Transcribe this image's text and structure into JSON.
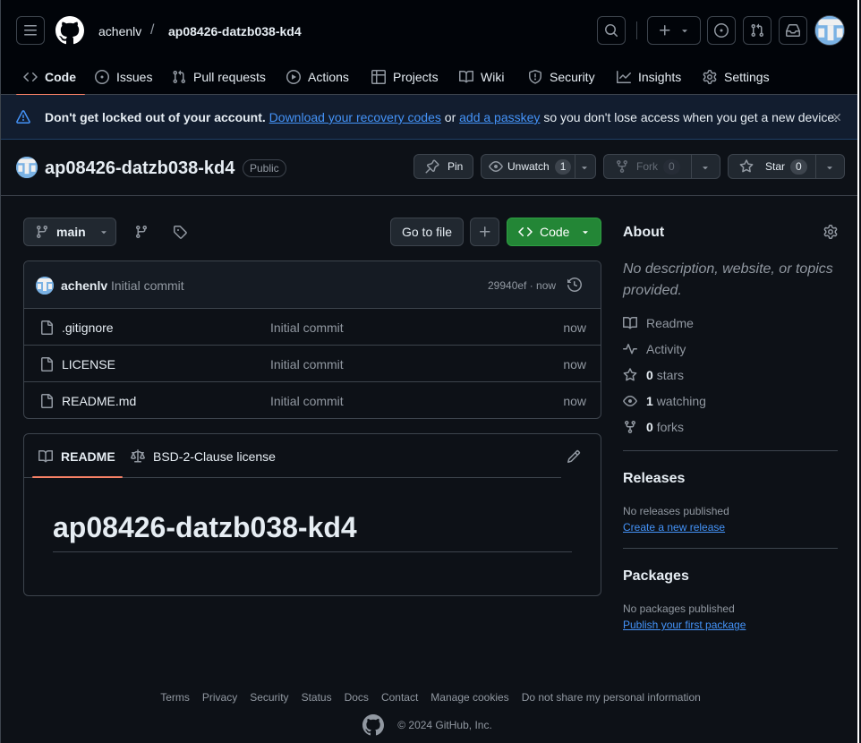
{
  "header": {
    "owner": "achenlv",
    "slash": "/",
    "repo": "ap08426-datzb038-kd4"
  },
  "tabs": [
    {
      "label": "Code"
    },
    {
      "label": "Issues"
    },
    {
      "label": "Pull requests"
    },
    {
      "label": "Actions"
    },
    {
      "label": "Projects"
    },
    {
      "label": "Wiki"
    },
    {
      "label": "Security"
    },
    {
      "label": "Insights"
    },
    {
      "label": "Settings"
    }
  ],
  "banner": {
    "lead": "Don't get locked out of your account.",
    "link1": "Download your recovery codes",
    "mid": "or",
    "link2": "add a passkey",
    "tail": "so you don't lose access when you get a new device."
  },
  "repo": {
    "name": "ap08426-datzb038-kd4",
    "visibility": "Public",
    "pin": "Pin",
    "watch": "Unwatch",
    "watch_count": "1",
    "fork": "Fork",
    "fork_count": "0",
    "star": "Star",
    "star_count": "0"
  },
  "toolbar": {
    "branch": "main",
    "go_to_file": "Go to file",
    "code": "Code"
  },
  "commit": {
    "author": "achenlv",
    "message": "Initial commit",
    "meta": "29940ef · now"
  },
  "files": [
    {
      "name": ".gitignore",
      "message": "Initial commit",
      "age": "now"
    },
    {
      "name": "LICENSE",
      "message": "Initial commit",
      "age": "now"
    },
    {
      "name": "README.md",
      "message": "Initial commit",
      "age": "now"
    }
  ],
  "readme": {
    "tab1": "README",
    "tab2": "BSD-2-Clause license",
    "heading": "ap08426-datzb038-kd4"
  },
  "about": {
    "title": "About",
    "description": "No description, website, or topics provided.",
    "readme": "Readme",
    "activity": "Activity",
    "stars_n": "0",
    "stars": "stars",
    "watching_n": "1",
    "watching": "watching",
    "forks_n": "0",
    "forks": "forks"
  },
  "releases": {
    "title": "Releases",
    "empty": "No releases published",
    "link": "Create a new release"
  },
  "packages": {
    "title": "Packages",
    "empty": "No packages published",
    "link": "Publish your first package"
  },
  "footer": {
    "links": [
      "Terms",
      "Privacy",
      "Security",
      "Status",
      "Docs",
      "Contact",
      "Manage cookies",
      "Do not share my personal information"
    ],
    "copyright": "© 2024 GitHub, Inc."
  },
  "colors": {
    "accent": "#238636",
    "link": "#4493f8",
    "tab_underline": "#f78166"
  }
}
